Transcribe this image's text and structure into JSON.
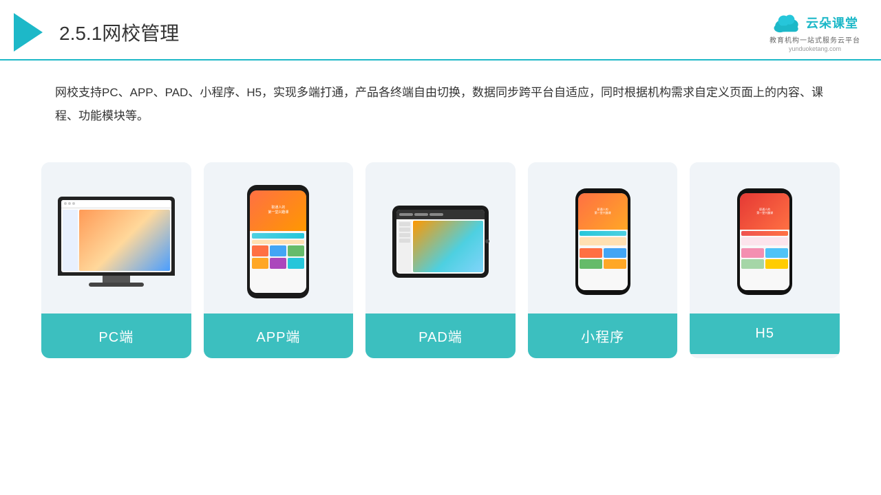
{
  "header": {
    "title_prefix": "2.5.1",
    "title_main": "网校管理",
    "logo_text": "云朵课堂",
    "logo_sub": "教育机构一站式服务云平台",
    "logo_domain": "yunduoketang.com"
  },
  "description": {
    "text": "网校支持PC、APP、PAD、小程序、H5，实现多端打通，产品各终端自由切换，数据同步跨平台自适应，同时根据机构需求自定义页面上的内容、课程、功能模块等。"
  },
  "cards": [
    {
      "id": "pc",
      "label": "PC端"
    },
    {
      "id": "app",
      "label": "APP端"
    },
    {
      "id": "pad",
      "label": "PAD端"
    },
    {
      "id": "miniapp",
      "label": "小程序"
    },
    {
      "id": "h5",
      "label": "H5"
    }
  ],
  "colors": {
    "teal": "#3cbfbf",
    "accent": "#1db8c8",
    "bg_card": "#f0f4f8"
  }
}
